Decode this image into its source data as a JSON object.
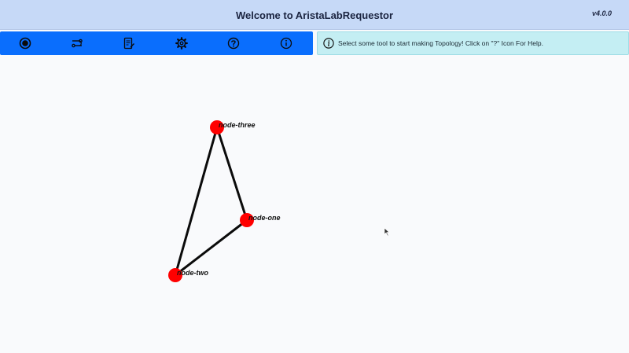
{
  "header": {
    "title": "Welcome to AristaLabRequestor",
    "version": "v4.0.0",
    "background_color": "#c6d9f7"
  },
  "toolbar": {
    "background_color": "#0a6efd",
    "tools": [
      {
        "icon": "record-icon"
      },
      {
        "icon": "link-icon"
      },
      {
        "icon": "notepad-icon"
      },
      {
        "icon": "gear-icon"
      },
      {
        "icon": "help-icon"
      },
      {
        "icon": "info-icon"
      }
    ]
  },
  "info_bar": {
    "icon": "info-icon",
    "message": "Select some tool to start making Topology! Click on \"?\" Icon For Help.",
    "background_color": "#c4eef3"
  },
  "topology": {
    "node_color": "#ff0000",
    "nodes": [
      {
        "id": "node-three",
        "label": "node-three"
      },
      {
        "id": "node-one",
        "label": "node-one"
      },
      {
        "id": "node-two",
        "label": "node-two"
      }
    ],
    "links": [
      {
        "from": "node-three",
        "to": "node-one"
      },
      {
        "from": "node-three",
        "to": "node-two"
      },
      {
        "from": "node-one",
        "to": "node-two"
      }
    ]
  }
}
